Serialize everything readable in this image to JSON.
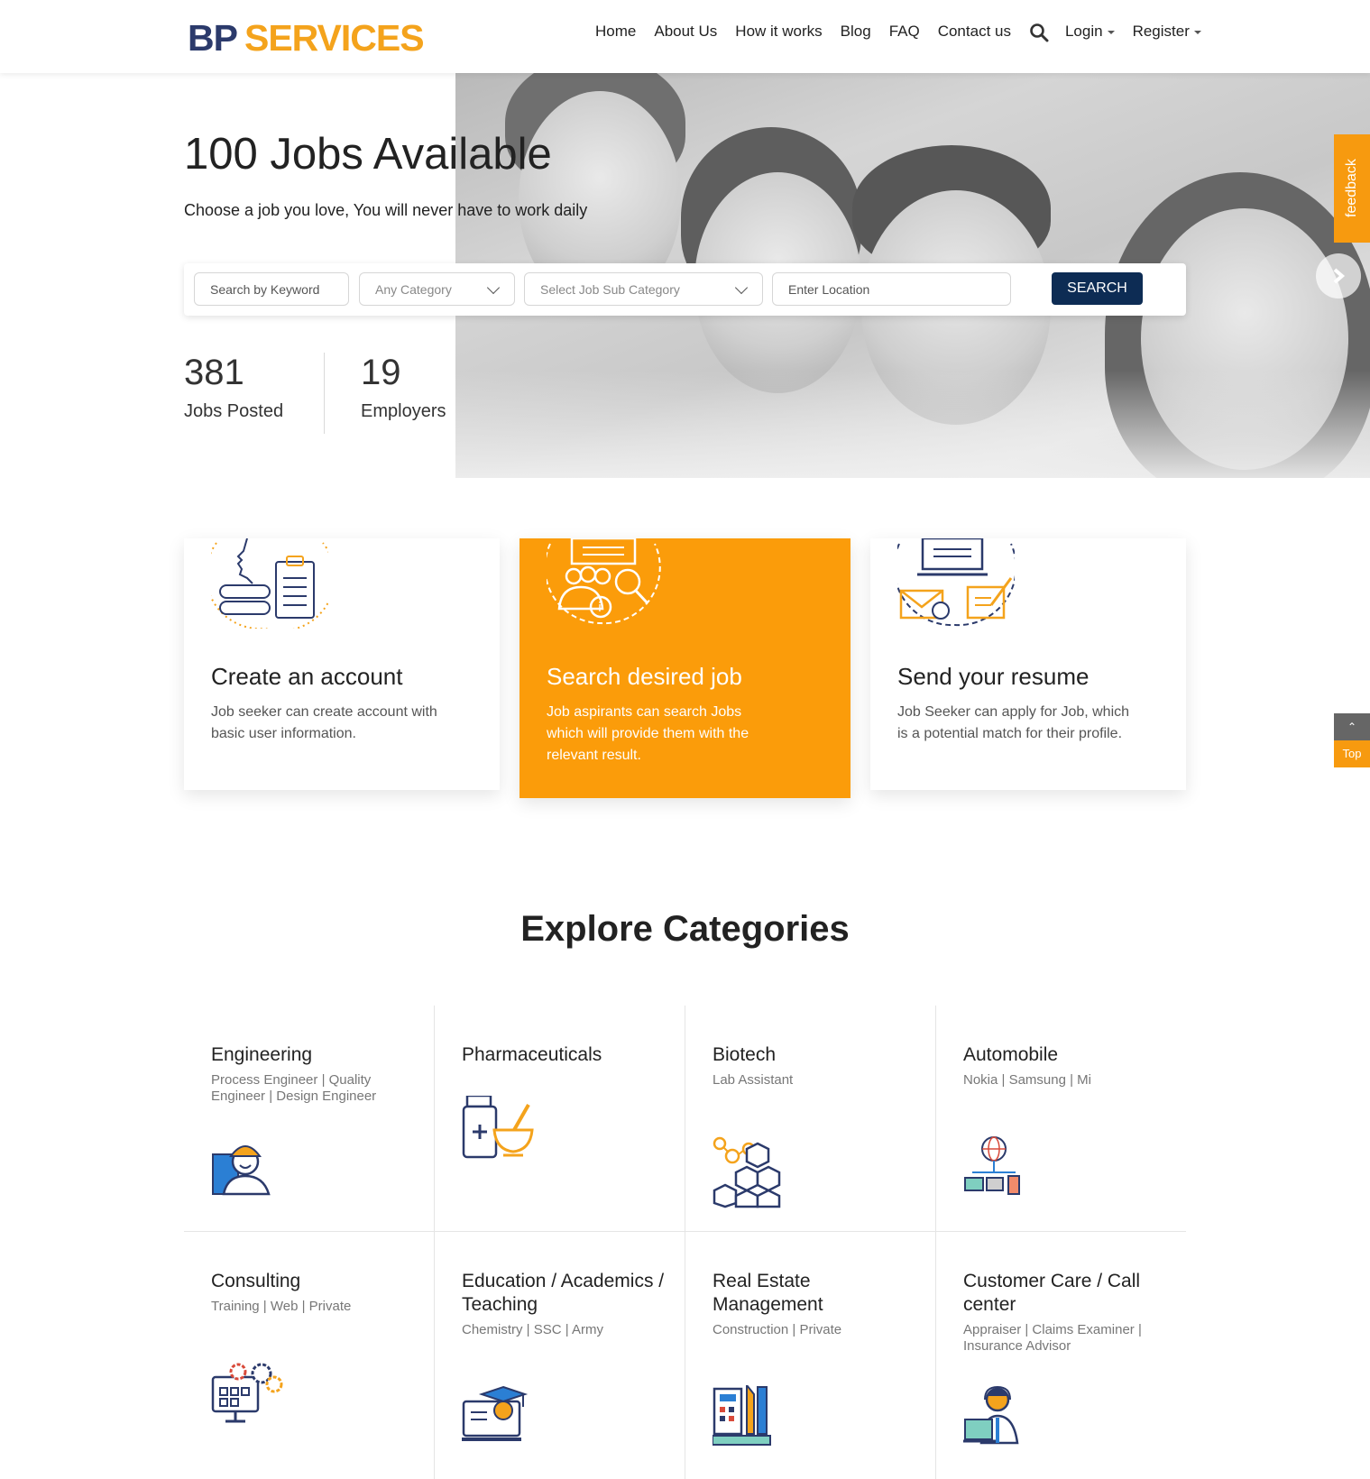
{
  "header": {
    "logo_left": "BP",
    "logo_right": "SERVICES",
    "nav": [
      "Home",
      "About Us",
      "How it works",
      "Blog",
      "FAQ",
      "Contact us"
    ],
    "login": "Login",
    "register": "Register"
  },
  "hero": {
    "title": "100 Jobs Available",
    "subtitle": "Choose a job you love, You will never have to work daily",
    "search": {
      "keyword_placeholder": "Search by Keyword",
      "category_value": "Any Category",
      "subcategory_value": "Select Job Sub Category",
      "location_placeholder": "Enter Location",
      "button": "SEARCH"
    },
    "stats": [
      {
        "value": "381",
        "label": "Jobs Posted"
      },
      {
        "value": "19",
        "label": "Employers"
      }
    ]
  },
  "side": {
    "feedback": "feedback",
    "top": "Top"
  },
  "steps": [
    {
      "title": "Create an account",
      "text": "Job seeker can create account with basic user information.",
      "icon": "account-setup-icon"
    },
    {
      "title": "Search desired job",
      "text": "Job aspirants can search Jobs which will provide them with the relevant result.",
      "icon": "job-search-icon"
    },
    {
      "title": "Send your resume",
      "text": "Job Seeker can apply for Job, which is a potential match for their profile.",
      "icon": "send-resume-icon"
    }
  ],
  "categories": {
    "title": "Explore Categories",
    "items": [
      {
        "name": "Engineering",
        "subs": "Process Engineer | Quality Engineer | Design Engineer",
        "icon": "engineer-icon"
      },
      {
        "name": "Pharmaceuticals",
        "subs": "",
        "icon": "medicine-icon"
      },
      {
        "name": "Biotech",
        "subs": "Lab Assistant",
        "icon": "molecule-icon"
      },
      {
        "name": "Automobile",
        "subs": "Nokia | Samsung | Mi",
        "icon": "network-icon"
      },
      {
        "name": "Consulting",
        "subs": "Training | Web | Private",
        "icon": "gears-monitor-icon"
      },
      {
        "name": "Education / Academics / Teaching",
        "subs": "Chemistry | SSC | Army",
        "icon": "graduation-icon"
      },
      {
        "name": "Real Estate Management",
        "subs": "Construction | Private",
        "icon": "calculator-ruler-icon"
      },
      {
        "name": "Customer Care / Call center",
        "subs": "Appraiser | Claims Examiner | Insurance Advisor",
        "icon": "support-agent-icon"
      }
    ]
  },
  "colors": {
    "accent": "#fb9c0a",
    "navy": "#0d2c54",
    "logo_blue": "#2b3a6b",
    "logo_orange": "#f4a31c"
  }
}
